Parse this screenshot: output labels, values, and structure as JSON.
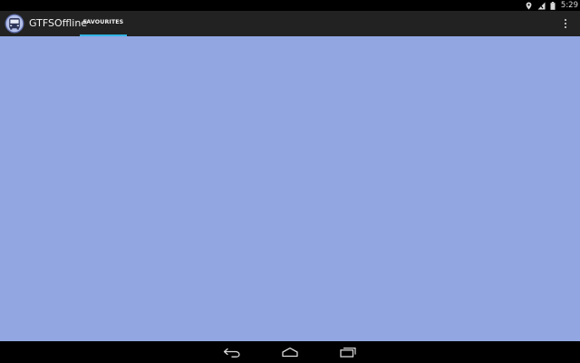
{
  "status_bar": {
    "time": "5:29",
    "icons": [
      "location-icon",
      "signal-icon",
      "battery-icon"
    ]
  },
  "action_bar": {
    "app_title": "GTFSOffline",
    "app_icon": "bus-icon",
    "tabs": [
      {
        "label": "FAVOURITES",
        "selected": true
      }
    ],
    "overflow_icon": "overflow-menu-icon"
  },
  "content": {
    "background_color": "#92a6e2"
  },
  "nav_bar": {
    "buttons": [
      "back-icon",
      "home-icon",
      "recents-icon"
    ]
  },
  "colors": {
    "action_bar": "#222222",
    "tab_indicator": "#33b5e5",
    "content": "#92a6e2"
  }
}
